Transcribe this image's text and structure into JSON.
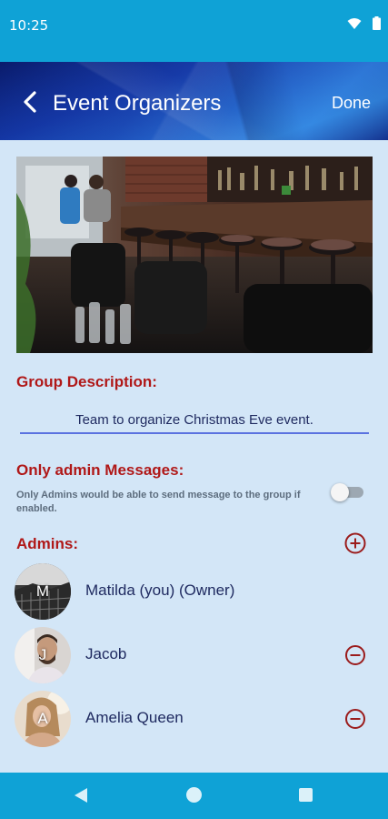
{
  "status_bar": {
    "time": "10:25",
    "wifi_icon": "wifi-icon",
    "battery_icon": "battery-icon"
  },
  "header": {
    "title": "Event Organizers",
    "done_label": "Done",
    "back_icon": "chevron-left-icon"
  },
  "hero_image": {
    "description_icon": "bar-interior-photo"
  },
  "group_description": {
    "label": "Group Description:",
    "value": "Team to organize Christmas Eve event."
  },
  "admin_messages": {
    "label": "Only admin Messages:",
    "hint": "Only Admins would be able to send message to the group if enabled.",
    "enabled": false
  },
  "admins": {
    "label": "Admins:",
    "add_icon": "plus-circle-icon",
    "members": [
      {
        "initial": "M",
        "name": "Matilda (you) (Owner)",
        "removable": false
      },
      {
        "initial": "J",
        "name": "Jacob",
        "removable": true,
        "remove_icon": "minus-circle-icon"
      },
      {
        "initial": "A",
        "name": "Amelia Queen",
        "removable": true,
        "remove_icon": "minus-circle-icon"
      }
    ]
  },
  "nav_bar": {
    "back_icon": "triangle-back-icon",
    "home_icon": "circle-home-icon",
    "recent_icon": "square-recent-icon"
  },
  "colors": {
    "accent": "#0fa2d6",
    "label_red": "#b01818",
    "text_navy": "#1f2a60",
    "background": "#d3e6f7"
  }
}
